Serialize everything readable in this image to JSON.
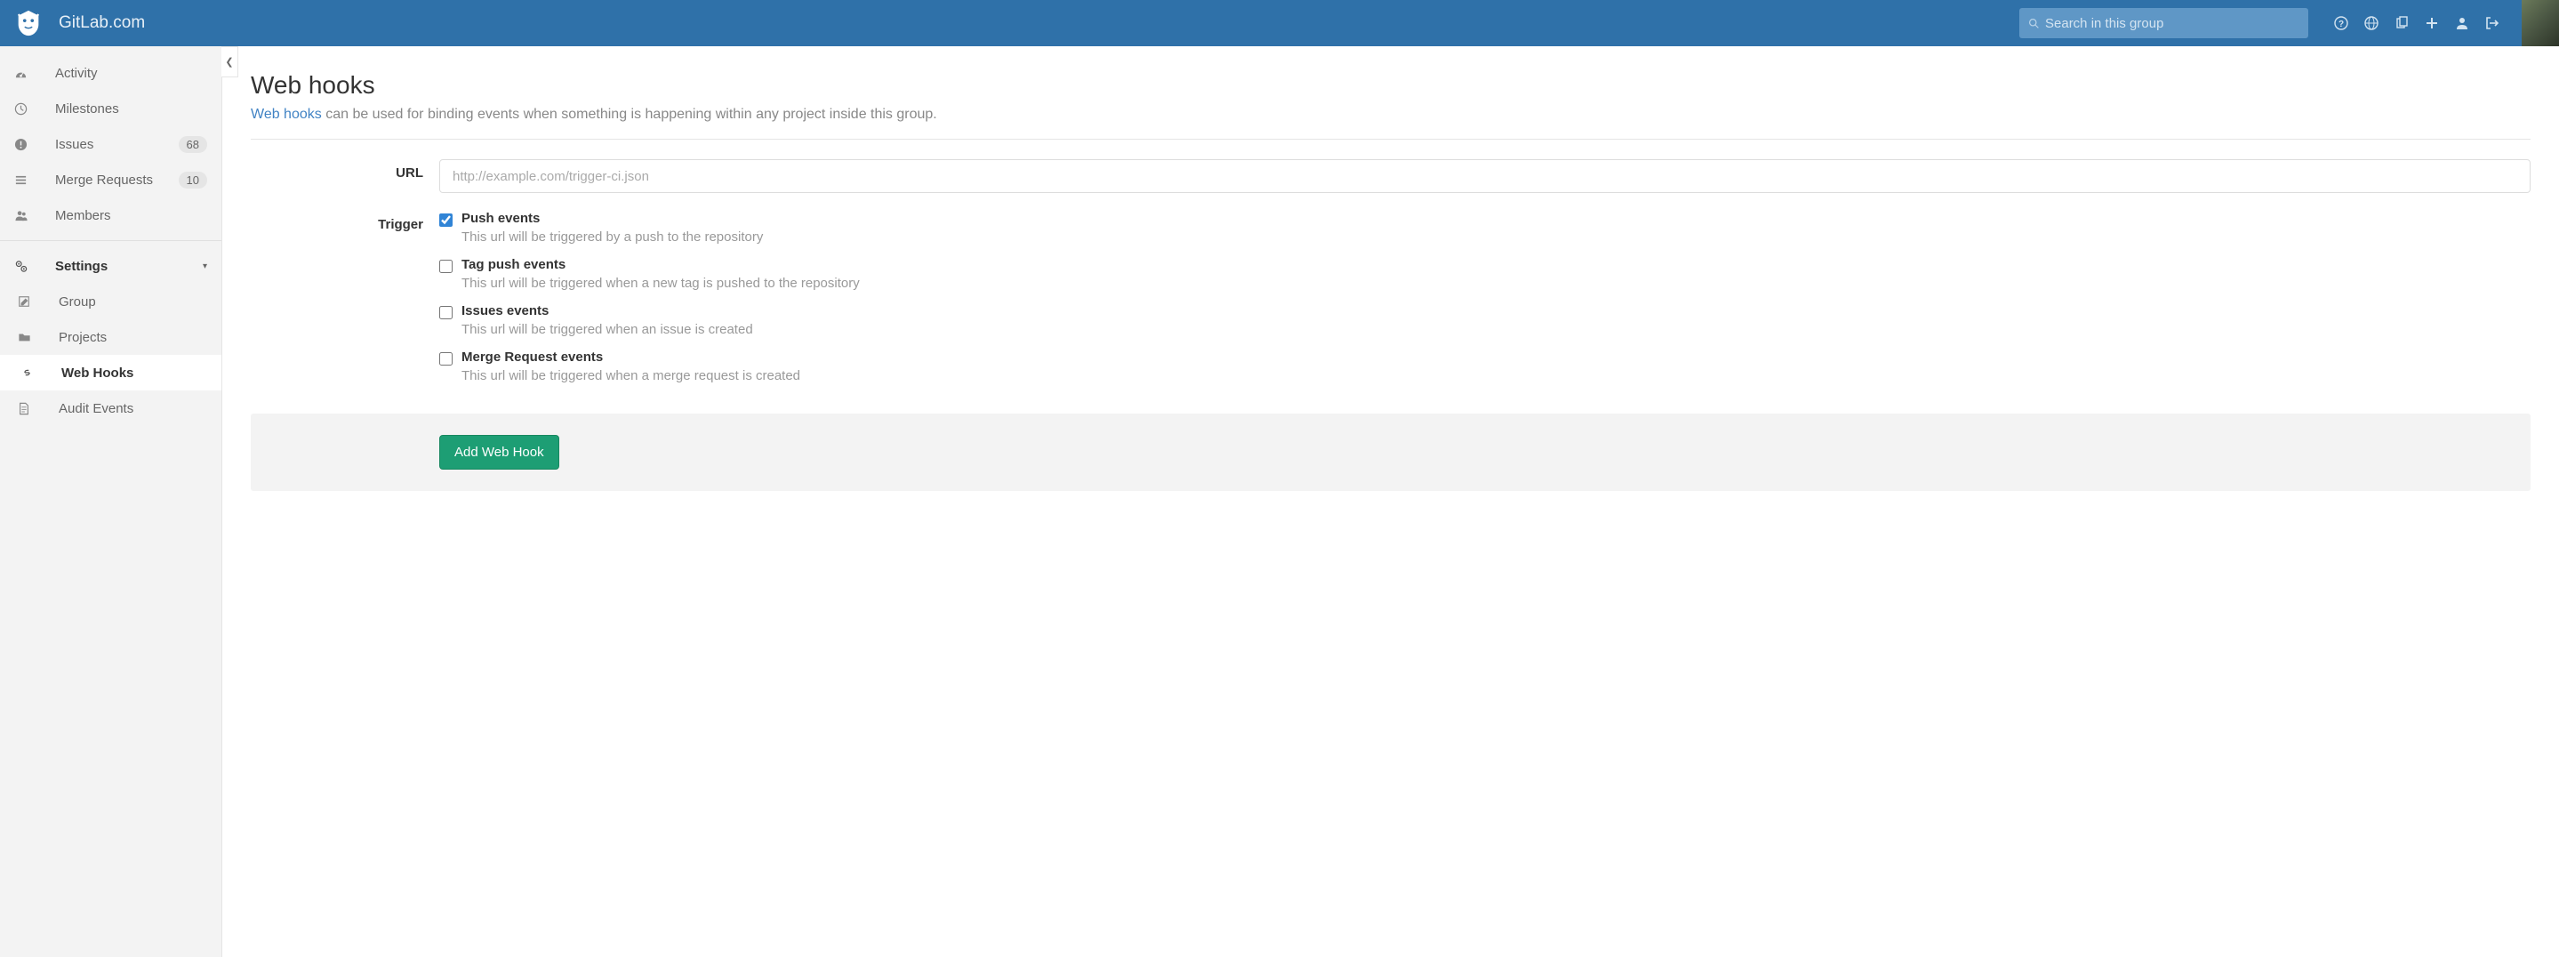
{
  "header": {
    "brand": "GitLab.com",
    "search_placeholder": "Search in this group"
  },
  "sidebar": {
    "items": [
      {
        "icon": "dashboard",
        "label": "Activity",
        "badge": null
      },
      {
        "icon": "clock",
        "label": "Milestones",
        "badge": null
      },
      {
        "icon": "exclaim",
        "label": "Issues",
        "badge": "68"
      },
      {
        "icon": "list",
        "label": "Merge Requests",
        "badge": "10"
      },
      {
        "icon": "users",
        "label": "Members",
        "badge": null
      }
    ],
    "settings_label": "Settings",
    "sub": [
      {
        "icon": "edit",
        "label": "Group"
      },
      {
        "icon": "folder",
        "label": "Projects"
      },
      {
        "icon": "link",
        "label": "Web Hooks"
      },
      {
        "icon": "file",
        "label": "Audit Events"
      }
    ]
  },
  "page": {
    "title": "Web hooks",
    "link_text": "Web hooks",
    "desc_rest": " can be used for binding events when something is happening within any project inside this group."
  },
  "form": {
    "url_label": "URL",
    "url_placeholder": "http://example.com/trigger-ci.json",
    "trigger_label": "Trigger",
    "triggers": [
      {
        "checked": true,
        "title": "Push events",
        "hint": "This url will be triggered by a push to the repository"
      },
      {
        "checked": false,
        "title": "Tag push events",
        "hint": "This url will be triggered when a new tag is pushed to the repository"
      },
      {
        "checked": false,
        "title": "Issues events",
        "hint": "This url will be triggered when an issue is created"
      },
      {
        "checked": false,
        "title": "Merge Request events",
        "hint": "This url will be triggered when a merge request is created"
      }
    ],
    "submit_label": "Add Web Hook"
  }
}
